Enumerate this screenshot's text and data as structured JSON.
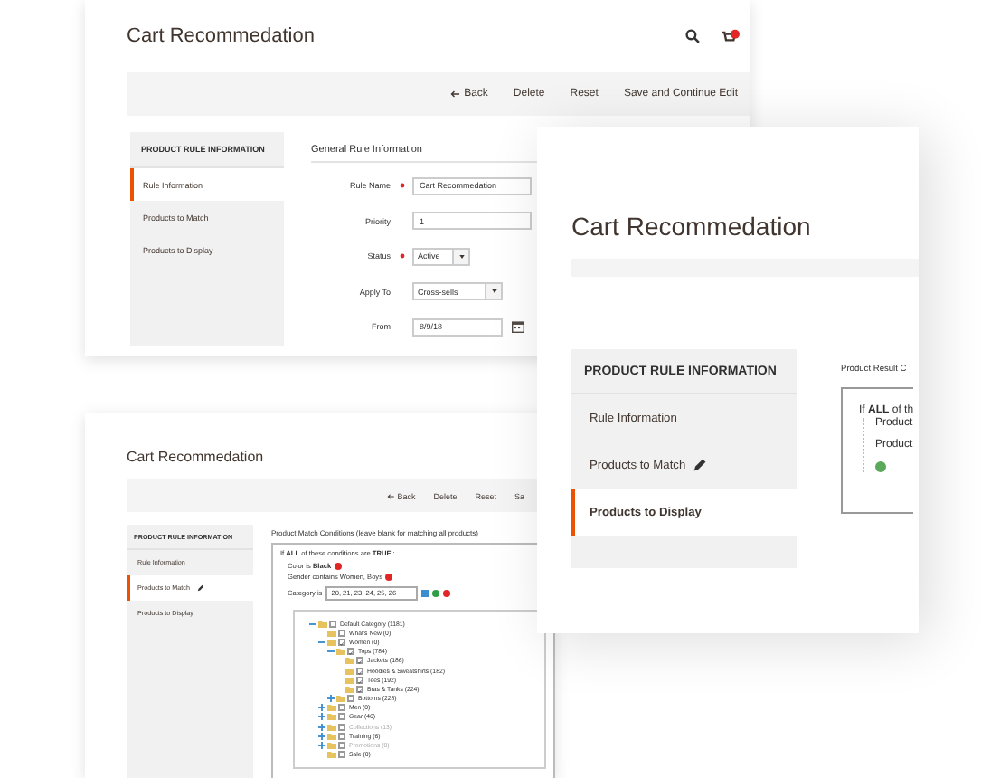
{
  "main_window": {
    "title": "Cart Recommedation",
    "toolbar": [
      "Back",
      "Delete",
      "Reset",
      "Save and Continue Edit"
    ],
    "sidebar": {
      "heading": "PRODUCT RULE INFORMATION",
      "items": [
        {
          "label": "Rule Information",
          "selected": true,
          "edited": false
        },
        {
          "label": "Products to Match",
          "selected": false,
          "edited": false
        },
        {
          "label": "Products to Display",
          "selected": false,
          "edited": false
        }
      ]
    },
    "section_title": "General Rule Information",
    "fields": [
      {
        "label": "Rule Name",
        "required": true,
        "kind": "text",
        "value": "Cart Recommedation"
      },
      {
        "label": "Priority",
        "required": false,
        "kind": "text",
        "value": "1"
      },
      {
        "label": "Status",
        "required": true,
        "kind": "select",
        "value": "Active"
      },
      {
        "label": "Apply To",
        "required": false,
        "kind": "select",
        "value": "Cross-sells"
      },
      {
        "label": "From",
        "required": false,
        "kind": "date",
        "value": "8/9/18"
      }
    ]
  },
  "match_window": {
    "title": "Cart Recommedation",
    "toolbar": [
      "Back",
      "Delete",
      "Reset",
      "Sa"
    ],
    "sidebar": {
      "heading": "PRODUCT RULE INFORMATION",
      "items": [
        {
          "label": "Rule Information",
          "selected": false,
          "edited": false
        },
        {
          "label": "Products to Match",
          "selected": true,
          "edited": true
        },
        {
          "label": "Products to Display",
          "selected": false,
          "edited": false
        }
      ]
    },
    "note": "Product Match Conditions (leave blank for matching all products)",
    "rule": "If **ALL** of these conditions are **TRUE** :",
    "conditions": [
      {
        "kind": "text",
        "text": "Color is **Black**"
      },
      {
        "kind": "text",
        "text": "Gender contains Women, Boys"
      },
      {
        "kind": "field",
        "text": "Category is",
        "value": "20, 21, 23, 24, 25, 26"
      }
    ],
    "tree": [
      {
        "label": "Default Category (1181)",
        "expanded": true,
        "checked": false,
        "disabled": false,
        "children": [
          {
            "label": "What's New (0)",
            "checked": false,
            "disabled": false
          },
          {
            "label": "Women (0)",
            "expanded": true,
            "checked": true,
            "disabled": false,
            "children": [
              {
                "label": "Tops (784)",
                "expanded": true,
                "checked": true,
                "disabled": false,
                "children": [
                  {
                    "label": "Jackets (186)",
                    "checked": true,
                    "disabled": false
                  },
                  {
                    "label": "Hoodies & Sweatshirts (182)",
                    "checked": true,
                    "disabled": false
                  },
                  {
                    "label": "Tees (192)",
                    "checked": true,
                    "disabled": false
                  },
                  {
                    "label": "Bras & Tanks (224)",
                    "checked": true,
                    "disabled": false
                  }
                ]
              },
              {
                "label": "Bottoms (228)",
                "expanded": false,
                "checked": false,
                "disabled": false
              }
            ]
          },
          {
            "label": "Men (0)",
            "expanded": false,
            "checked": false,
            "disabled": false
          },
          {
            "label": "Gear (46)",
            "expanded": false,
            "checked": false,
            "disabled": false
          },
          {
            "label": "Collections (13)",
            "expanded": false,
            "checked": false,
            "disabled": true
          },
          {
            "label": "Training (6)",
            "expanded": false,
            "checked": false,
            "disabled": false
          },
          {
            "label": "Promotions (0)",
            "expanded": false,
            "checked": false,
            "disabled": true
          },
          {
            "label": "Sale (0)",
            "checked": false,
            "disabled": false
          }
        ]
      }
    ]
  },
  "display_window": {
    "title": "Cart Recommedation",
    "sidebar": {
      "heading": "PRODUCT RULE INFORMATION",
      "items": [
        {
          "label": "Rule Information",
          "selected": false,
          "edited": false
        },
        {
          "label": "Products to Match",
          "selected": false,
          "edited": true
        },
        {
          "label": "Products to Display",
          "selected": true,
          "edited": false
        }
      ]
    },
    "note": "Product Result C",
    "rule": "If **ALL** of th",
    "conditions": [
      "Product",
      "Product"
    ]
  }
}
